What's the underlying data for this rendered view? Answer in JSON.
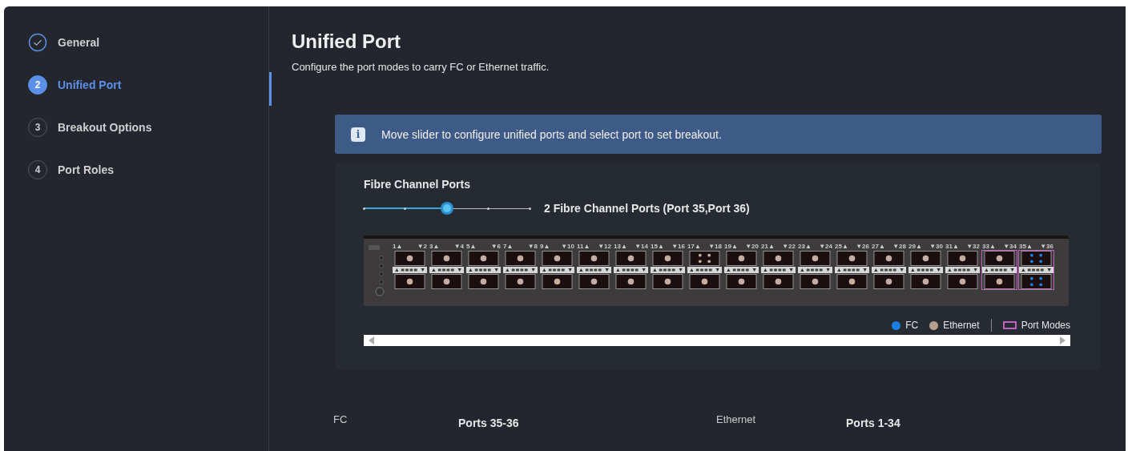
{
  "steps": [
    {
      "label": "General",
      "completed": true,
      "selected": false
    },
    {
      "number": "2",
      "label": "Unified Port",
      "completed": false,
      "selected": true
    },
    {
      "number": "3",
      "label": "Breakout Options",
      "completed": false,
      "selected": false
    },
    {
      "number": "4",
      "label": "Port Roles",
      "completed": false,
      "selected": false
    }
  ],
  "page": {
    "title": "Unified Port",
    "subtitle": "Configure the port modes to carry FC or Ethernet traffic."
  },
  "info_banner": {
    "icon": "i",
    "text": "Move slider to configure unified ports and select port to set breakout."
  },
  "fc_ports": {
    "title": "Fibre Channel Ports",
    "slider": {
      "level": 0.5
    },
    "reading": "2 Fibre Channel Ports (Port 35,Port 36)"
  },
  "switch_modules": [
    {
      "top_label": "1▲",
      "bottom_label": "▼2",
      "ports": [
        {
          "kind": "ethernet"
        },
        {
          "kind": "ethernet"
        }
      ],
      "port_mode": false
    },
    {
      "top_label": "3▲",
      "bottom_label": "▼4",
      "ports": [
        {
          "kind": "ethernet"
        },
        {
          "kind": "ethernet"
        }
      ],
      "port_mode": false
    },
    {
      "top_label": "5▲",
      "bottom_label": "▼6",
      "ports": [
        {
          "kind": "ethernet"
        },
        {
          "kind": "ethernet"
        }
      ],
      "port_mode": false
    },
    {
      "top_label": "7▲",
      "bottom_label": "▼8",
      "ports": [
        {
          "kind": "ethernet"
        },
        {
          "kind": "ethernet"
        }
      ],
      "port_mode": false
    },
    {
      "top_label": "9▲",
      "bottom_label": "▼10",
      "ports": [
        {
          "kind": "ethernet"
        },
        {
          "kind": "ethernet"
        }
      ],
      "port_mode": false
    },
    {
      "top_label": "11▲",
      "bottom_label": "▼12",
      "ports": [
        {
          "kind": "ethernet"
        },
        {
          "kind": "ethernet"
        }
      ],
      "port_mode": false
    },
    {
      "top_label": "13▲",
      "bottom_label": "▼14",
      "ports": [
        {
          "kind": "ethernet"
        },
        {
          "kind": "ethernet"
        }
      ],
      "port_mode": false
    },
    {
      "top_label": "15▲",
      "bottom_label": "▼16",
      "ports": [
        {
          "kind": "ethernet"
        },
        {
          "kind": "ethernet"
        }
      ],
      "port_mode": false
    },
    {
      "top_label": "17▲",
      "bottom_label": "▼18",
      "ports": [
        {
          "kind": "breakout"
        },
        {
          "kind": "ethernet"
        }
      ],
      "port_mode": false
    },
    {
      "top_label": "19▲",
      "bottom_label": "▼20",
      "ports": [
        {
          "kind": "ethernet"
        },
        {
          "kind": "ethernet"
        }
      ],
      "port_mode": false
    },
    {
      "top_label": "21▲",
      "bottom_label": "▼22",
      "ports": [
        {
          "kind": "ethernet"
        },
        {
          "kind": "ethernet"
        }
      ],
      "port_mode": false
    },
    {
      "top_label": "23▲",
      "bottom_label": "▼24",
      "ports": [
        {
          "kind": "ethernet"
        },
        {
          "kind": "ethernet"
        }
      ],
      "port_mode": false
    },
    {
      "top_label": "25▲",
      "bottom_label": "▼26",
      "ports": [
        {
          "kind": "ethernet"
        },
        {
          "kind": "ethernet"
        }
      ],
      "port_mode": false
    },
    {
      "top_label": "27▲",
      "bottom_label": "▼28",
      "ports": [
        {
          "kind": "ethernet"
        },
        {
          "kind": "ethernet"
        }
      ],
      "port_mode": false
    },
    {
      "top_label": "29▲",
      "bottom_label": "▼30",
      "ports": [
        {
          "kind": "ethernet"
        },
        {
          "kind": "ethernet"
        }
      ],
      "port_mode": false
    },
    {
      "top_label": "31▲",
      "bottom_label": "▼32",
      "ports": [
        {
          "kind": "ethernet"
        },
        {
          "kind": "ethernet"
        }
      ],
      "port_mode": false
    },
    {
      "top_label": "33▲",
      "bottom_label": "▼34",
      "ports": [
        {
          "kind": "ethernet"
        },
        {
          "kind": "ethernet"
        }
      ],
      "port_mode": true
    },
    {
      "top_label": "35▲",
      "bottom_label": "▼36",
      "ports": [
        {
          "kind": "fcbreakout"
        },
        {
          "kind": "fcbreakout"
        }
      ],
      "port_mode": true
    }
  ],
  "legend": [
    {
      "kind": "dot",
      "label": "FC",
      "color": "#1a7fe0"
    },
    {
      "kind": "dot",
      "label": "Ethernet",
      "color": "#b89e8e"
    },
    {
      "kind": "outline",
      "label": "Port Modes",
      "color": "#c060c0"
    }
  ],
  "summary": [
    {
      "label": "FC",
      "value": "Ports 35-36"
    },
    {
      "label": "Ethernet",
      "value": "Ports 1-34"
    }
  ]
}
